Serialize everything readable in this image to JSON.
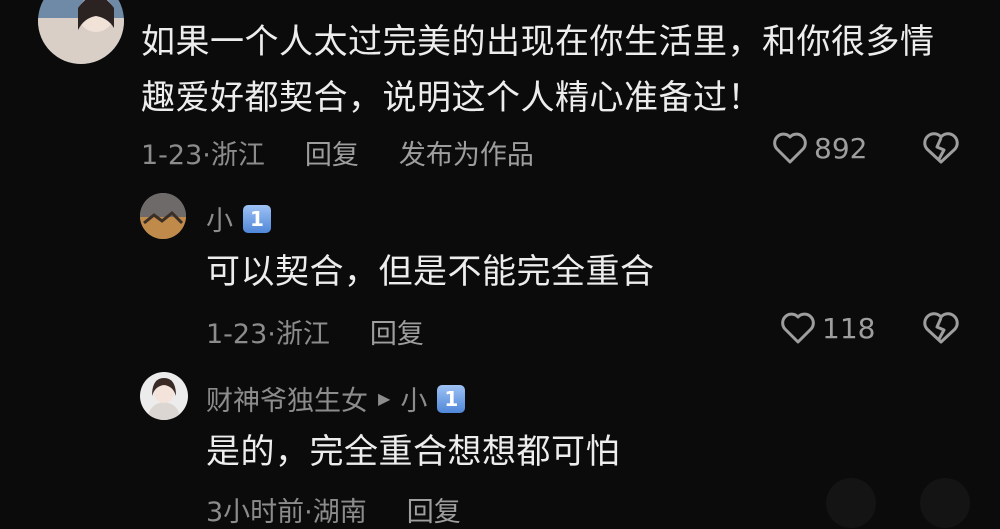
{
  "comments": [
    {
      "text": "如果一个人太过完美的出现在你生活里，和你很多情趣爱好都契合，说明这个人精心准备过！",
      "date": "1-23·浙江",
      "reply_label": "回复",
      "publish_label": "发布为作品",
      "likes": "892"
    },
    {
      "username": "小",
      "badge": "1",
      "text": "可以契合，但是不能完全重合",
      "date": "1-23·浙江",
      "reply_label": "回复",
      "likes": "118"
    },
    {
      "username": "财神爷独生女",
      "reply_to": "小",
      "badge": "1",
      "text": "是的，完全重合想想都可怕",
      "date": "3小时前·湖南",
      "reply_label": "回复"
    }
  ],
  "icons": {
    "like": "heart-outline-icon",
    "dislike": "broken-heart-icon",
    "reply_arrow": "triangle-right-icon"
  },
  "colors": {
    "background": "#0b0b0b",
    "primary_text": "#ededed",
    "secondary_text": "#8c8c8c",
    "badge": "#4f87d9"
  }
}
